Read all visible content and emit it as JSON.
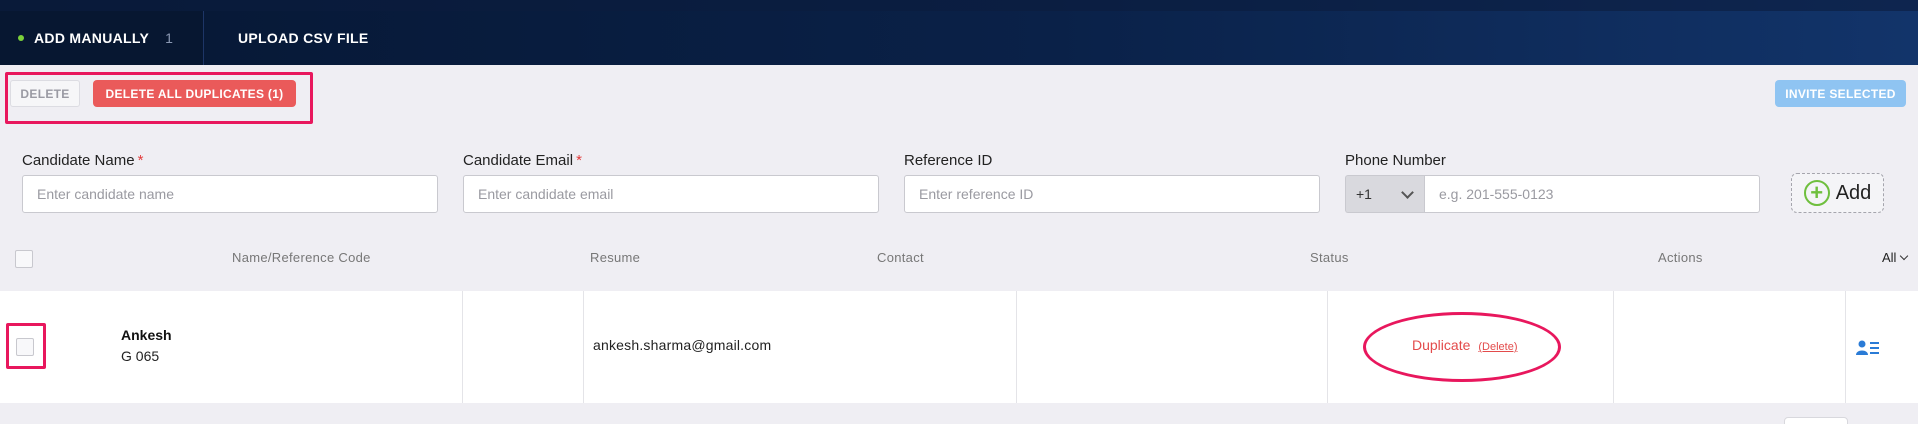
{
  "tabs": {
    "manual": {
      "label": "ADD MANUALLY",
      "count": "1"
    },
    "csv": {
      "label": "UPLOAD CSV FILE"
    }
  },
  "actions": {
    "delete_label": "DELETE",
    "delete_duplicates_label": "DELETE ALL DUPLICATES (1)",
    "invite_label": "INVITE SELECTED"
  },
  "form": {
    "name": {
      "label": "Candidate Name",
      "required": "*",
      "placeholder": "Enter candidate name"
    },
    "email": {
      "label": "Candidate Email",
      "required": "*",
      "placeholder": "Enter candidate email"
    },
    "reference": {
      "label": "Reference ID",
      "placeholder": "Enter reference ID"
    },
    "phone": {
      "label": "Phone Number",
      "country_code": "+1",
      "placeholder": "e.g. 201-555-0123"
    },
    "add_label": "Add"
  },
  "table": {
    "columns": {
      "name": "Name/Reference Code",
      "resume": "Resume",
      "contact": "Contact",
      "status": "Status",
      "actions": "Actions"
    },
    "filter": "All",
    "rows": [
      {
        "name": "Ankesh",
        "code": "G 065",
        "email": "ankesh.sharma@gmail.com",
        "status": "Duplicate",
        "status_action": "(Delete)"
      }
    ]
  },
  "colors": {
    "header_dark": "#071731",
    "accent_red": "#ea5a5a",
    "highlight": "#e8175d",
    "invite_blue": "#8fc4f2",
    "add_green": "#6fbf3e",
    "status_red": "#e34b4b"
  },
  "icons": {
    "active_dot": "green-dot-icon",
    "add": "plus-circle-icon",
    "country_dropdown": "chevron-down-icon",
    "filter": "chevron-down-icon",
    "row_action": "profile-list-icon"
  }
}
